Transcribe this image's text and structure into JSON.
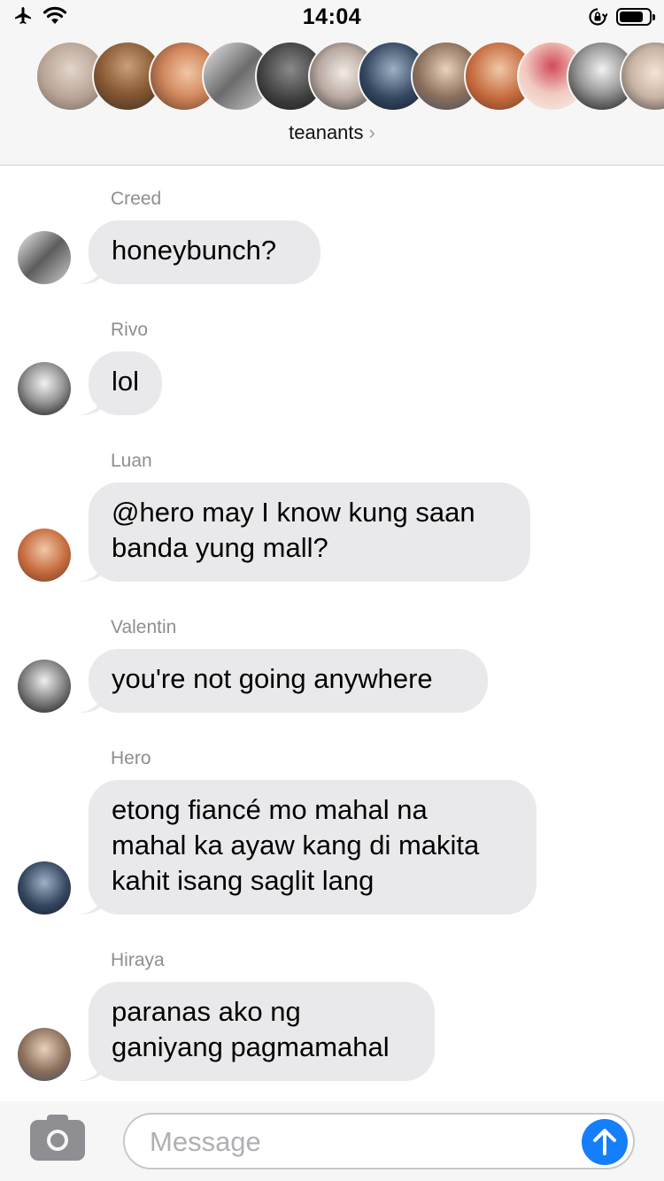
{
  "status_bar": {
    "time": "14:04",
    "icons": [
      "airplane-icon",
      "wifi-icon",
      "orientation-lock-icon",
      "battery-icon"
    ]
  },
  "conversation": {
    "title": "teanants",
    "participant_avatar_count": 12
  },
  "messages": [
    {
      "sender": "Creed",
      "text": "honeybunch?"
    },
    {
      "sender": "Rivo",
      "text": "lol"
    },
    {
      "sender": "Luan",
      "text": "@hero may I know kung saan\nbanda yung mall?"
    },
    {
      "sender": "Valentin",
      "text": "you're not going anywhere"
    },
    {
      "sender": "Hero",
      "text": "etong fiancé mo mahal na\nmahal ka ayaw kang di makita\nkahit isang saglit lang"
    },
    {
      "sender": "Hiraya",
      "text": "paranas ako ng\nganiyang pagmamahal"
    }
  ],
  "input": {
    "placeholder": "Message"
  },
  "colors": {
    "bubble": "#e9e9eb",
    "sender_name": "#8e8e93",
    "send_button": "#147efb",
    "header_bg": "#f6f6f6"
  }
}
